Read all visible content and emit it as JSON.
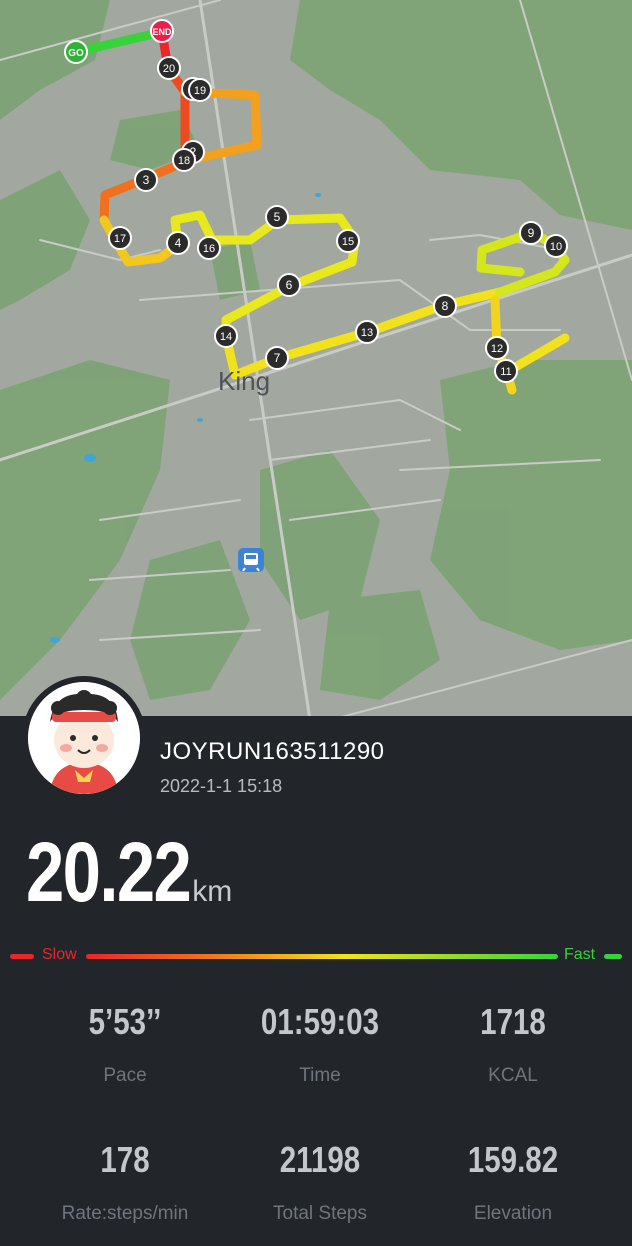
{
  "map": {
    "place_label": "King",
    "start_marker": "GO",
    "end_marker": "END",
    "km_markers": [
      "1",
      "2",
      "3",
      "4",
      "5",
      "6",
      "7",
      "8",
      "9",
      "10",
      "11",
      "12",
      "13",
      "14",
      "15",
      "16",
      "17",
      "18",
      "19",
      "20"
    ],
    "transit_icon": "train-station-icon"
  },
  "profile": {
    "username": "JOYRUN163511290",
    "datetime": "2022-1-1 15:18"
  },
  "distance": {
    "value": "20.22",
    "unit": "km"
  },
  "speed_legend": {
    "slow": "Slow",
    "fast": "Fast"
  },
  "stats": [
    {
      "value": "5’53’’",
      "label": "Pace"
    },
    {
      "value": "01:59:03",
      "label": "Time"
    },
    {
      "value": "1718",
      "label": "KCAL"
    },
    {
      "value": "178",
      "label": "Rate:steps/min"
    },
    {
      "value": "21198",
      "label": "Total Steps"
    },
    {
      "value": "159.82",
      "label": "Elevation"
    }
  ],
  "colors": {
    "background": "#22262b",
    "slow": "#e8262b",
    "fast": "#38d23b",
    "map_land": "#9eaa98",
    "map_green": "#7ea276"
  }
}
